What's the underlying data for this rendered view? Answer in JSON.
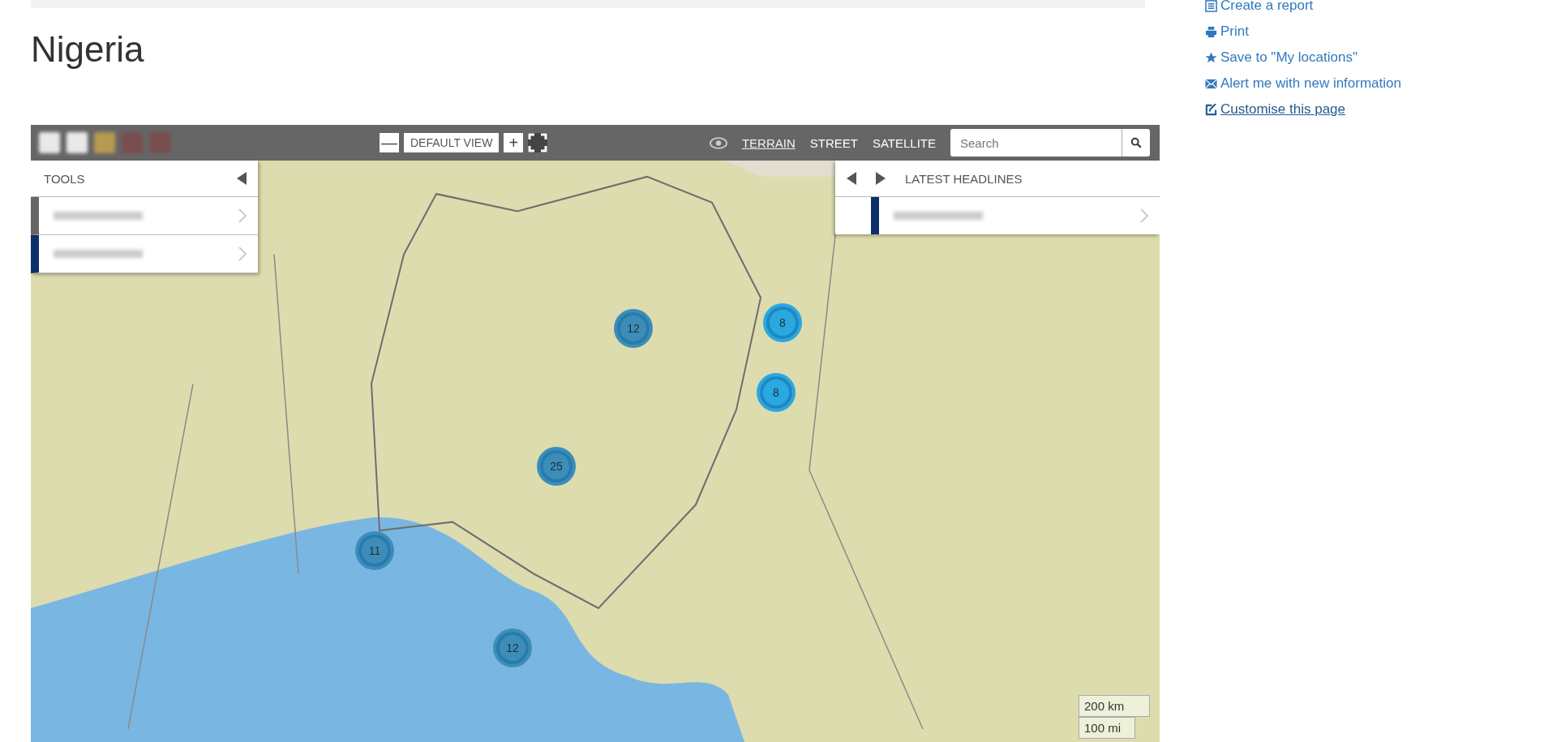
{
  "page_title": "Nigeria",
  "map": {
    "zoom_out": "—",
    "default_view": "DEFAULT VIEW",
    "zoom_in": "+",
    "layers": [
      {
        "label": "TERRAIN",
        "selected": true
      },
      {
        "label": "STREET",
        "selected": false
      },
      {
        "label": "SATELLITE",
        "selected": false
      }
    ],
    "search": {
      "placeholder": "Search"
    },
    "tools_panel": {
      "title": "TOOLS"
    },
    "headlines_panel": {
      "title": "LATEST HEADLINES"
    },
    "clusters": [
      {
        "count": "12",
        "color": "#3d8db8"
      },
      {
        "count": "8",
        "color": "#2aa8e0"
      },
      {
        "count": "8",
        "color": "#2aa8e0"
      },
      {
        "count": "25",
        "color": "#3d8db8"
      },
      {
        "count": "11",
        "color": "#3d8db8"
      },
      {
        "count": "12",
        "color": "#3d8db8"
      }
    ],
    "scale": [
      "200 km",
      "100 mi"
    ]
  },
  "actions": [
    {
      "kind": "report",
      "label": "Create a report"
    },
    {
      "kind": "print",
      "label": "Print"
    },
    {
      "kind": "star",
      "label": "Save to \"My locations\""
    },
    {
      "kind": "mail",
      "label": "Alert me with new information"
    },
    {
      "kind": "edit",
      "label": "Customise this page"
    }
  ]
}
